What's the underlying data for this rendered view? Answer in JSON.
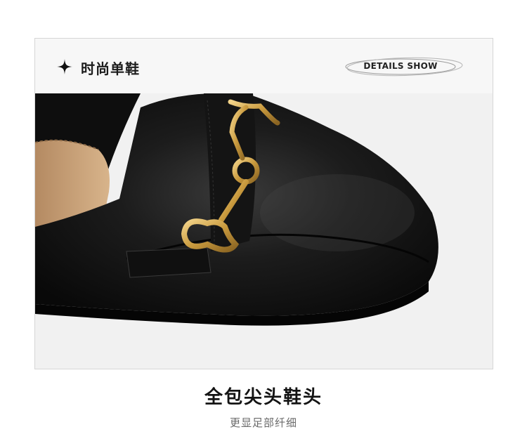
{
  "header": {
    "title": "时尚单鞋",
    "details_label": "DETAILS SHOW"
  },
  "product_image": {
    "subject": "black leather pointed-toe loafer with gold horsebit buckle"
  },
  "feature": {
    "headline": "全包尖头鞋头",
    "subline": "更显足部纤细"
  },
  "colors": {
    "leather": "#151515",
    "gold": "#c99a3e",
    "lining": "#c9a077"
  }
}
